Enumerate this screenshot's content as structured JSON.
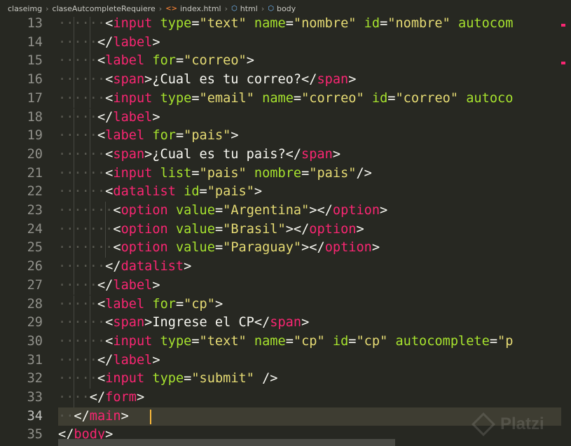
{
  "breadcrumb": {
    "items": [
      "claseimg",
      "claseAutcompleteRequiere",
      "index.html",
      "html",
      "body"
    ],
    "html_icon": "<>",
    "cube_icon": "⬡"
  },
  "editor": {
    "lines": [
      {
        "n": "13",
        "ws": "······",
        "tokens": [
          [
            "p",
            "<"
          ],
          [
            "tag",
            "input"
          ],
          [
            "p",
            " "
          ],
          [
            "attr",
            "type"
          ],
          [
            "p",
            "="
          ],
          [
            "str",
            "\"text\""
          ],
          [
            "p",
            " "
          ],
          [
            "attr",
            "name"
          ],
          [
            "p",
            "="
          ],
          [
            "str",
            "\"nombre\""
          ],
          [
            "p",
            " "
          ],
          [
            "attr",
            "id"
          ],
          [
            "p",
            "="
          ],
          [
            "str",
            "\"nombre\""
          ],
          [
            "p",
            " "
          ],
          [
            "attr",
            "autocom"
          ]
        ]
      },
      {
        "n": "14",
        "ws": "·····",
        "tokens": [
          [
            "p",
            "</"
          ],
          [
            "tag",
            "label"
          ],
          [
            "p",
            ">"
          ]
        ]
      },
      {
        "n": "15",
        "ws": "·····",
        "tokens": [
          [
            "p",
            "<"
          ],
          [
            "tag",
            "label"
          ],
          [
            "p",
            " "
          ],
          [
            "attr",
            "for"
          ],
          [
            "p",
            "="
          ],
          [
            "str",
            "\"correo\""
          ],
          [
            "p",
            ">"
          ]
        ]
      },
      {
        "n": "16",
        "ws": "······",
        "tokens": [
          [
            "p",
            "<"
          ],
          [
            "tag",
            "span"
          ],
          [
            "p",
            ">¿Cual es tu correo?</"
          ],
          [
            "tag",
            "span"
          ],
          [
            "p",
            ">"
          ]
        ]
      },
      {
        "n": "17",
        "ws": "······",
        "tokens": [
          [
            "p",
            "<"
          ],
          [
            "tag",
            "input"
          ],
          [
            "p",
            " "
          ],
          [
            "attr",
            "type"
          ],
          [
            "p",
            "="
          ],
          [
            "str",
            "\"email\""
          ],
          [
            "p",
            " "
          ],
          [
            "attr",
            "name"
          ],
          [
            "p",
            "="
          ],
          [
            "str",
            "\"correo\""
          ],
          [
            "p",
            " "
          ],
          [
            "attr",
            "id"
          ],
          [
            "p",
            "="
          ],
          [
            "str",
            "\"correo\""
          ],
          [
            "p",
            " "
          ],
          [
            "attr",
            "autoco"
          ]
        ]
      },
      {
        "n": "18",
        "ws": "·····",
        "tokens": [
          [
            "p",
            "</"
          ],
          [
            "tag",
            "label"
          ],
          [
            "p",
            ">"
          ]
        ]
      },
      {
        "n": "19",
        "ws": "·····",
        "tokens": [
          [
            "p",
            "<"
          ],
          [
            "tag",
            "label"
          ],
          [
            "p",
            " "
          ],
          [
            "attr",
            "for"
          ],
          [
            "p",
            "="
          ],
          [
            "str",
            "\"pais\""
          ],
          [
            "p",
            ">"
          ]
        ]
      },
      {
        "n": "20",
        "ws": "······",
        "tokens": [
          [
            "p",
            "<"
          ],
          [
            "tag",
            "span"
          ],
          [
            "p",
            ">¿Cual es tu pais?</"
          ],
          [
            "tag",
            "span"
          ],
          [
            "p",
            ">"
          ]
        ]
      },
      {
        "n": "21",
        "ws": "······",
        "tokens": [
          [
            "p",
            "<"
          ],
          [
            "tag",
            "input"
          ],
          [
            "p",
            " "
          ],
          [
            "attr",
            "list"
          ],
          [
            "p",
            "="
          ],
          [
            "str",
            "\"pais\""
          ],
          [
            "p",
            " "
          ],
          [
            "attr",
            "nombre"
          ],
          [
            "p",
            "="
          ],
          [
            "str",
            "\"pais\""
          ],
          [
            "p",
            "/>"
          ]
        ]
      },
      {
        "n": "22",
        "ws": "······",
        "tokens": [
          [
            "p",
            "<"
          ],
          [
            "tag",
            "datalist"
          ],
          [
            "p",
            " "
          ],
          [
            "attr",
            "id"
          ],
          [
            "p",
            "="
          ],
          [
            "str",
            "\"pais\""
          ],
          [
            "p",
            ">"
          ]
        ]
      },
      {
        "n": "23",
        "ws": "·······",
        "tokens": [
          [
            "p",
            "<"
          ],
          [
            "tag",
            "option"
          ],
          [
            "p",
            " "
          ],
          [
            "attr",
            "value"
          ],
          [
            "p",
            "="
          ],
          [
            "str",
            "\"Argentina\""
          ],
          [
            "p",
            "></"
          ],
          [
            "tag",
            "option"
          ],
          [
            "p",
            ">"
          ]
        ]
      },
      {
        "n": "24",
        "ws": "·······",
        "tokens": [
          [
            "p",
            "<"
          ],
          [
            "tag",
            "option"
          ],
          [
            "p",
            " "
          ],
          [
            "attr",
            "value"
          ],
          [
            "p",
            "="
          ],
          [
            "str",
            "\"Brasil\""
          ],
          [
            "p",
            "></"
          ],
          [
            "tag",
            "option"
          ],
          [
            "p",
            ">"
          ]
        ]
      },
      {
        "n": "25",
        "ws": "·······",
        "tokens": [
          [
            "p",
            "<"
          ],
          [
            "tag",
            "option"
          ],
          [
            "p",
            " "
          ],
          [
            "attr",
            "value"
          ],
          [
            "p",
            "="
          ],
          [
            "str",
            "\"Paraguay\""
          ],
          [
            "p",
            "></"
          ],
          [
            "tag",
            "option"
          ],
          [
            "p",
            ">"
          ]
        ]
      },
      {
        "n": "26",
        "ws": "······",
        "tokens": [
          [
            "p",
            "</"
          ],
          [
            "tag",
            "datalist"
          ],
          [
            "p",
            ">"
          ]
        ]
      },
      {
        "n": "27",
        "ws": "·····",
        "tokens": [
          [
            "p",
            "</"
          ],
          [
            "tag",
            "label"
          ],
          [
            "p",
            ">"
          ]
        ]
      },
      {
        "n": "28",
        "ws": "·····",
        "tokens": [
          [
            "p",
            "<"
          ],
          [
            "tag",
            "label"
          ],
          [
            "p",
            " "
          ],
          [
            "attr",
            "for"
          ],
          [
            "p",
            "="
          ],
          [
            "str",
            "\"cp\""
          ],
          [
            "p",
            ">"
          ]
        ]
      },
      {
        "n": "29",
        "ws": "······",
        "tokens": [
          [
            "p",
            "<"
          ],
          [
            "tag",
            "span"
          ],
          [
            "p",
            ">Ingrese el CP</"
          ],
          [
            "tag",
            "span"
          ],
          [
            "p",
            ">"
          ]
        ]
      },
      {
        "n": "30",
        "ws": "······",
        "tokens": [
          [
            "p",
            "<"
          ],
          [
            "tag",
            "input"
          ],
          [
            "p",
            " "
          ],
          [
            "attr",
            "type"
          ],
          [
            "p",
            "="
          ],
          [
            "str",
            "\"text\""
          ],
          [
            "p",
            " "
          ],
          [
            "attr",
            "name"
          ],
          [
            "p",
            "="
          ],
          [
            "str",
            "\"cp\""
          ],
          [
            "p",
            " "
          ],
          [
            "attr",
            "id"
          ],
          [
            "p",
            "="
          ],
          [
            "str",
            "\"cp\""
          ],
          [
            "p",
            " "
          ],
          [
            "attr",
            "autocomplete"
          ],
          [
            "p",
            "="
          ],
          [
            "str",
            "\"p"
          ]
        ]
      },
      {
        "n": "31",
        "ws": "·····",
        "tokens": [
          [
            "p",
            "</"
          ],
          [
            "tag",
            "label"
          ],
          [
            "p",
            ">"
          ]
        ]
      },
      {
        "n": "32",
        "ws": "·····",
        "tokens": [
          [
            "p",
            "<"
          ],
          [
            "tag",
            "input"
          ],
          [
            "p",
            " "
          ],
          [
            "attr",
            "type"
          ],
          [
            "p",
            "="
          ],
          [
            "str",
            "\"submit\""
          ],
          [
            "p",
            " />"
          ]
        ]
      },
      {
        "n": "33",
        "ws": "····",
        "tokens": [
          [
            "p",
            "</"
          ],
          [
            "tag",
            "form"
          ],
          [
            "p",
            ">"
          ]
        ]
      },
      {
        "n": "34",
        "ws": "··",
        "tokens": [
          [
            "p",
            "</"
          ],
          [
            "tag",
            "main"
          ],
          [
            "p",
            ">"
          ]
        ]
      },
      {
        "n": "35",
        "ws": "",
        "tokens": [
          [
            "p",
            "</"
          ],
          [
            "tag",
            "body"
          ],
          [
            "p",
            ">"
          ]
        ]
      }
    ],
    "current_line": "34"
  },
  "watermark": {
    "text": "Platzi"
  },
  "colors": {
    "background": "#272822",
    "tag": "#f92672",
    "attribute": "#a6e22e",
    "string": "#e6db74",
    "text": "#f8f8f2",
    "line_number": "#90908a",
    "cursor": "#f8b73a"
  }
}
